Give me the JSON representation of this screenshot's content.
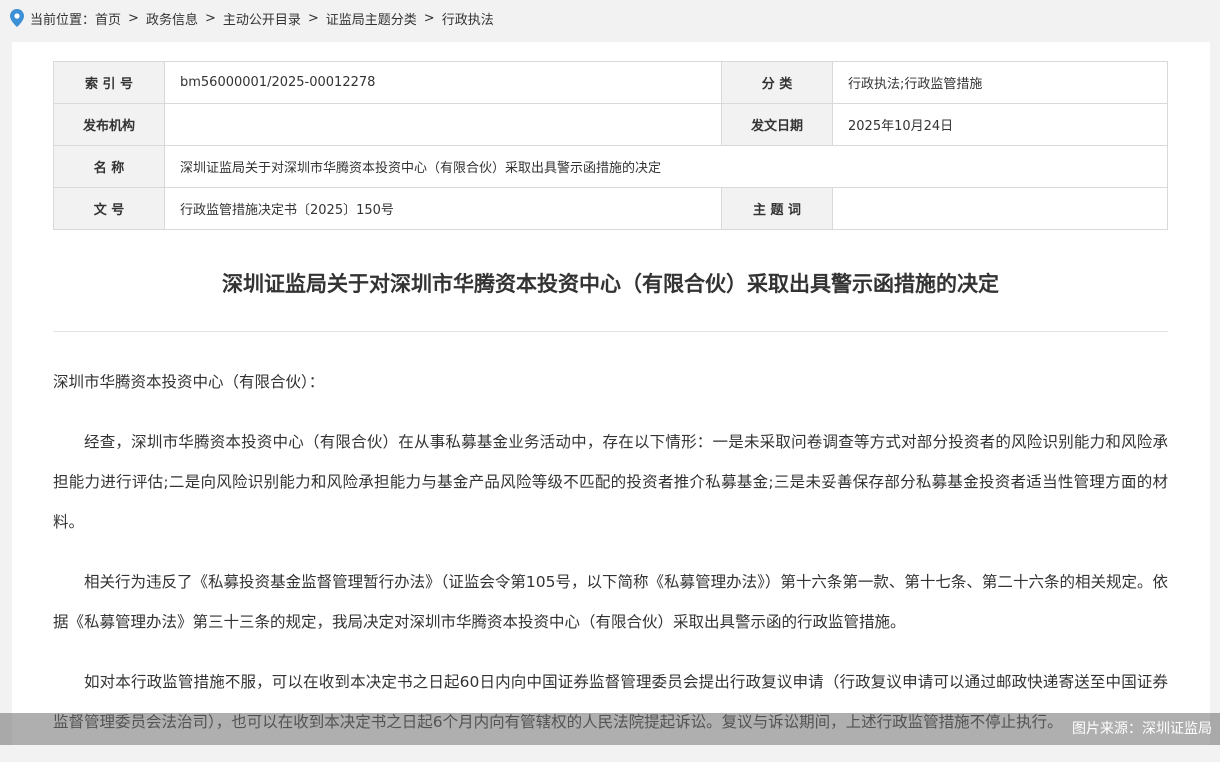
{
  "breadcrumb": {
    "label": "当前位置：",
    "items": [
      "首页",
      "政务信息",
      "主动公开目录",
      "证监局主题分类",
      "行政执法"
    ],
    "separator": ">"
  },
  "meta": {
    "index_key": "索 引 号",
    "index_value": "bm56000001/2025-00012278",
    "category_key": "分 类",
    "category_value": "行政执法;行政监管措施",
    "issuer_key": "发布机构",
    "issuer_value": "",
    "date_key": "发文日期",
    "date_value": "2025年10月24日",
    "name_key": "名 称",
    "name_value": "深圳证监局关于对深圳市华腾资本投资中心（有限合伙）采取出具警示函措施的决定",
    "doc_no_key": "文 号",
    "doc_no_value": "行政监管措施决定书〔2025〕150号",
    "keywords_key": "主 题 词",
    "keywords_value": ""
  },
  "document": {
    "title": "深圳证监局关于对深圳市华腾资本投资中心（有限合伙）采取出具警示函措施的决定",
    "salutation": "深圳市华腾资本投资中心（有限合伙）：",
    "paragraphs": [
      "经查，深圳市华腾资本投资中心（有限合伙）在从事私募基金业务活动中，存在以下情形：一是未采取问卷调查等方式对部分投资者的风险识别能力和风险承担能力进行评估;二是向风险识别能力和风险承担能力与基金产品风险等级不匹配的投资者推介私募基金;三是未妥善保存部分私募基金投资者适当性管理方面的材料。",
      "相关行为违反了《私募投资基金监督管理暂行办法》（证监会令第105号，以下简称《私募管理办法》）第十六条第一款、第十七条、第二十六条的相关规定。依据《私募管理办法》第三十三条的规定，我局决定对深圳市华腾资本投资中心（有限合伙）采取出具警示函的行政监管措施。",
      "如对本行政监管措施不服，可以在收到本决定书之日起60日内向中国证券监督管理委员会提出行政复议申请（行政复议申请可以通过邮政快递寄送至中国证券监督管理委员会法治司），也可以在收到本决定书之日起6个月内向有管辖权的人民法院提起诉讼。复议与诉讼期间，上述行政监管措施不停止执行。"
    ]
  },
  "caption": "图片来源：深圳证监局",
  "colors": {
    "pin": "#3d8fd6",
    "label_bg": "#f2f2f2",
    "border": "#d9d9d9"
  }
}
